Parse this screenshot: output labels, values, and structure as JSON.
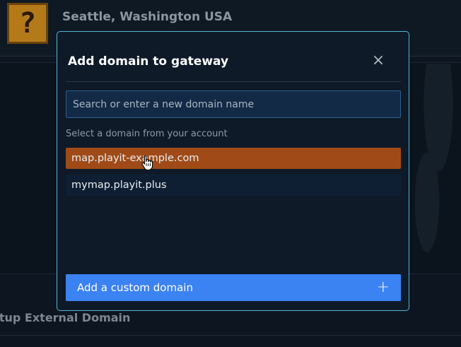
{
  "background": {
    "location_title": "Seattle, Washington USA",
    "logo_glyph": "?",
    "section_title": "etup External Domain"
  },
  "modal": {
    "title": "Add domain to gateway",
    "close_icon": "×",
    "search": {
      "placeholder": "Search or enter a new domain name",
      "value": ""
    },
    "section_label": "Select a domain from your account",
    "domains": [
      {
        "label": "map.playit-example.com",
        "selected": true
      },
      {
        "label": "mymap.playit.plus",
        "selected": false
      }
    ],
    "add_custom_label": "Add a custom domain",
    "add_custom_icon": "+"
  },
  "colors": {
    "accent_border": "#57b4d6",
    "selected_item": "#a04b17",
    "primary_button": "#3b82f2"
  }
}
